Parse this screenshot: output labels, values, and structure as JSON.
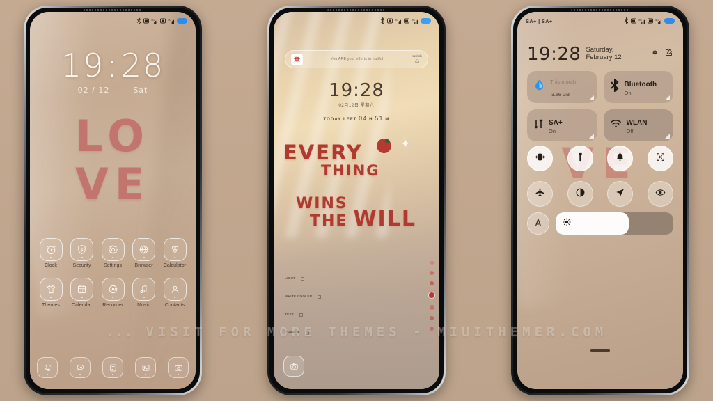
{
  "background_color": "#c3a890",
  "accent_red": "#b03a30",
  "phones": {
    "phone1": {
      "name": "Lock screen / Home screen",
      "status_bar": {
        "left_text": "",
        "icons": [
          "bluetooth-icon",
          "sim1-icon",
          "signal1-icon",
          "sim2-icon",
          "signal2-icon",
          "battery-icon"
        ]
      },
      "clock": {
        "hours": "19",
        "colon": ":",
        "minutes": "28",
        "date": "02 / 12",
        "weekday": "Sat"
      },
      "wallpaper_art": {
        "line1": "LO",
        "line2": "VE"
      },
      "apps_row1": [
        {
          "label": "Clock",
          "icon": "alarm-clock-icon"
        },
        {
          "label": "Security",
          "icon": "shield-icon"
        },
        {
          "label": "Settings",
          "icon": "gear-icon"
        },
        {
          "label": "Browser",
          "icon": "globe-icon"
        },
        {
          "label": "Calculator",
          "icon": "calculator-icon"
        }
      ],
      "apps_row2": [
        {
          "label": "Themes",
          "icon": "tshirt-icon"
        },
        {
          "label": "Calendar",
          "icon": "calendar-icon"
        },
        {
          "label": "Recorder",
          "icon": "recorder-icon"
        },
        {
          "label": "Music",
          "icon": "music-note-icon"
        },
        {
          "label": "Contacts",
          "icon": "person-icon"
        }
      ],
      "dock": [
        {
          "label": "Phone",
          "icon": "phone-icon"
        },
        {
          "label": "Messages",
          "icon": "chat-bubble-icon"
        },
        {
          "label": "Notes",
          "icon": "notes-icon"
        },
        {
          "label": "Gallery",
          "icon": "image-icon"
        },
        {
          "label": "Camera",
          "icon": "camera-icon"
        }
      ]
    },
    "phone2": {
      "name": "Second home screen with widget",
      "status_bar": {
        "icons": [
          "bluetooth-icon",
          "sim1-icon",
          "signal1-icon",
          "sim2-icon",
          "signal2-icon",
          "battery-icon"
        ]
      },
      "widget_pill": {
        "badge_text": "幸",
        "message": "You ARE your efforts in fruitful.",
        "right_caption": "switch",
        "right_face": "☺"
      },
      "clock": {
        "time": "19:28",
        "date": "02月12日 星期六",
        "left_label": "TODAY LEFT",
        "left_hours": "04",
        "left_hours_unit": "H",
        "left_minutes": "51",
        "left_minutes_unit": "M"
      },
      "quote": {
        "line1": "EVERY",
        "line2": "THING",
        "line3": "WINS",
        "line4": "THE",
        "line4_big": "WILL"
      },
      "side_labels": [
        {
          "text": "LIGHT"
        },
        {
          "text": "WHITE\nCOOLER"
        },
        {
          "text": "TEXT"
        },
        {
          "text": "CHANGE"
        }
      ],
      "app_strip_count": 7,
      "camera_button": "camera-icon"
    },
    "phone3": {
      "name": "Control center",
      "status_bar": {
        "left_text": "SA+ | SA+",
        "icons": [
          "bluetooth-icon",
          "sim1-icon",
          "signal1-icon",
          "sim2-icon",
          "signal2-icon",
          "battery-icon"
        ]
      },
      "header": {
        "time": "19:28",
        "date": "Saturday, February 12",
        "gear_icon": "gear-icon",
        "edit_icon": "edit-icon"
      },
      "big_tiles": [
        {
          "title": "This month",
          "value": "3.56",
          "unit": "GB",
          "icon": "data-drop-icon",
          "state": ""
        },
        {
          "title": "Bluetooth",
          "subtitle": "On",
          "icon": "bluetooth-icon",
          "state": "On"
        },
        {
          "title": "SA+",
          "subtitle": "On",
          "icon": "mobile-data-icon",
          "state": "On"
        },
        {
          "title": "WLAN",
          "subtitle": "Off",
          "icon": "wifi-icon",
          "state": "Off"
        }
      ],
      "toggles_row1": [
        {
          "name": "vibrate",
          "icon": "vibrate-icon",
          "on": true
        },
        {
          "name": "flashlight",
          "icon": "flashlight-icon",
          "on": true
        },
        {
          "name": "ringtone",
          "icon": "bell-icon",
          "on": true
        },
        {
          "name": "screenshot",
          "icon": "scissors-screenshot-icon",
          "on": true
        }
      ],
      "toggles_row2": [
        {
          "name": "airplane-mode",
          "icon": "airplane-icon",
          "on": false
        },
        {
          "name": "dark-mode",
          "icon": "dark-mode-icon",
          "on": false
        },
        {
          "name": "location",
          "icon": "location-arrow-icon",
          "on": false
        },
        {
          "name": "reading-mode",
          "icon": "eye-icon",
          "on": false
        }
      ],
      "brightness": {
        "auto_label": "A",
        "icon": "brightness-sun-icon",
        "level_percent": 62
      },
      "ghost_art": "VE"
    }
  },
  "watermark": {
    "prefix": "...",
    "text": "VISIT FOR MORE THEMES",
    "separator": "-",
    "site": "MIUITHEMER.COM"
  }
}
